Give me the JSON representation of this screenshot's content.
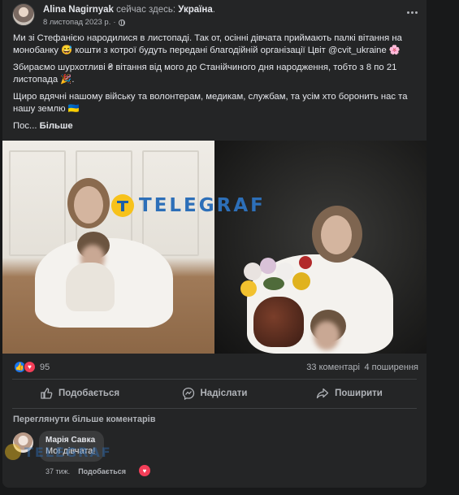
{
  "post": {
    "author": "Alina Nagirnyak",
    "author_suffix": " сейчас здесь: ",
    "place": "Україна",
    "place_end": ".",
    "date": "8 листопад 2023 р.",
    "date_sep": "·",
    "paragraphs": [
      "Ми зі Стефанією народилися в листопаді. Так от, осінні дівчата приймають палкі вітання на монобанку 😅 кошти з котрої будуть передані благодійній організації Цвіт @cvit_ukraine 🌸",
      "Збираємо шурхотливі ₴ вітання від мого до Станійчиного дня народження, тобто з 8 по 21 листопада 🎉.",
      "Щиро вдячні нашому війську та волонтерам, медикам, службам, та усім хто боронить нас та нашу землю 🇺🇦"
    ],
    "truncated": "Пос...",
    "see_more": "Більше"
  },
  "watermark": {
    "text": "TELEGRAF"
  },
  "stats": {
    "reactions": "95",
    "comments": "33 коментарі",
    "shares": "4 поширення"
  },
  "actions": {
    "like": "Подобається",
    "comment": "Надіслати",
    "share": "Поширити"
  },
  "comments_section": {
    "more": "Переглянути більше коментарів",
    "items": [
      {
        "name": "Марія Савка",
        "text": "Мої дівчата!",
        "time": "37 тиж.",
        "like": "Подобається"
      }
    ]
  },
  "icons": {
    "more": "more-horizontal-icon",
    "globe": "globe-icon",
    "like": "thumbs-up-icon",
    "love": "heart-icon",
    "comment": "messenger-icon",
    "share": "share-arrow-icon"
  },
  "colors": {
    "background": "#18191a",
    "card": "#242526",
    "text": "#e4e6eb",
    "muted": "#b0b3b8",
    "like_blue": "#1877f2",
    "love_red": "#f33e58",
    "watermark_yellow": "#f7c21b",
    "watermark_blue": "#2d6fb8"
  }
}
